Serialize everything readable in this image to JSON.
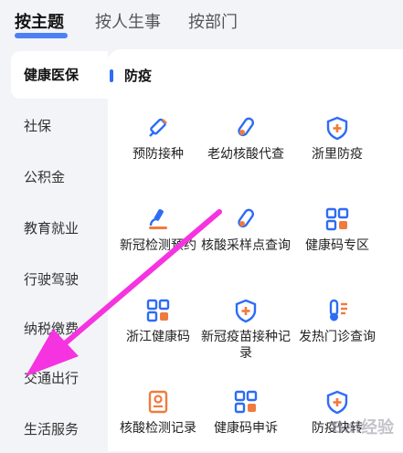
{
  "tabs": [
    "按主题",
    "按人生事",
    "按部门"
  ],
  "sidebar": [
    "健康医保",
    "社保",
    "公积金",
    "教育就业",
    "行驶驾驶",
    "纳税缴费",
    "交通出行",
    "生活服务"
  ],
  "section_title": "防疫",
  "services": [
    {
      "label": "预防接种",
      "icon": "syringe-icon"
    },
    {
      "label": "老幼核酸代查",
      "icon": "test-tube-icon"
    },
    {
      "label": "浙里防疫",
      "icon": "shield-plus-icon"
    },
    {
      "label": "新冠检测预约",
      "icon": "microscope-icon"
    },
    {
      "label": "核酸采样点查询",
      "icon": "test-tube-icon"
    },
    {
      "label": "健康码专区",
      "icon": "qr-code-icon"
    },
    {
      "label": "浙江健康码",
      "icon": "qr-code-icon"
    },
    {
      "label": "新冠疫苗接种记录",
      "icon": "shield-plus-icon"
    },
    {
      "label": "发热门诊查询",
      "icon": "thermometer-icon"
    },
    {
      "label": "核酸检测记录",
      "icon": "id-card-icon"
    },
    {
      "label": "健康码申诉",
      "icon": "qr-code-icon"
    },
    {
      "label": "防疫快转",
      "icon": "shield-plus-icon"
    }
  ],
  "watermark": "Bai经验",
  "colors": {
    "accent": "#2d6cf5",
    "icon_orange": "#f07b3f",
    "arrow": "#f533e0"
  }
}
